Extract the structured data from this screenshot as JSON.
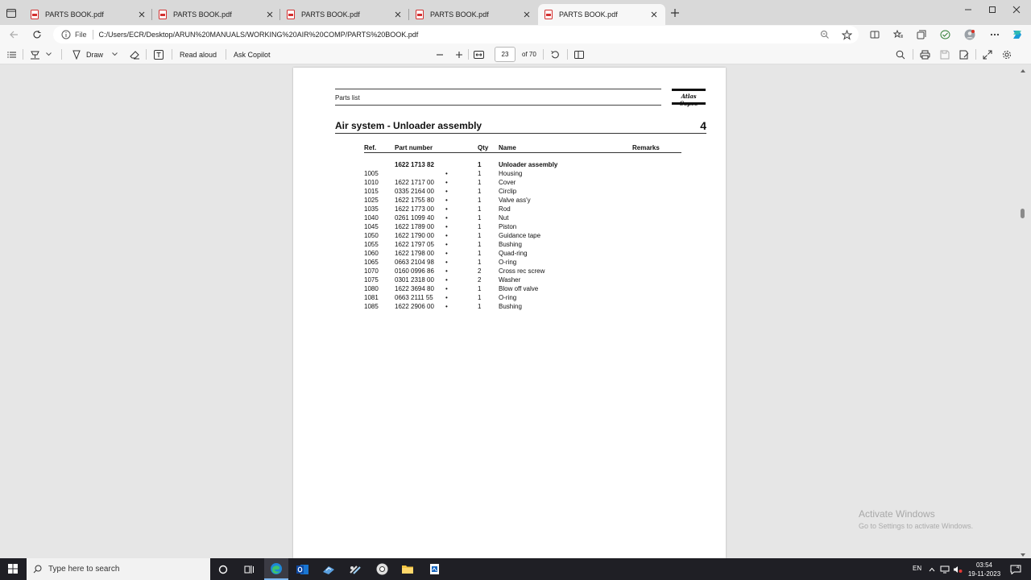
{
  "browser": {
    "tabs": [
      {
        "label": "PARTS BOOK.pdf",
        "active": false
      },
      {
        "label": "PARTS BOOK.pdf",
        "active": false
      },
      {
        "label": "PARTS BOOK.pdf",
        "active": false
      },
      {
        "label": "PARTS BOOK.pdf",
        "active": false
      },
      {
        "label": "PARTS BOOK.pdf",
        "active": true
      }
    ],
    "address": {
      "scheme_label": "File",
      "url": "C:/Users/ECR/Desktop/ARUN%20MANUALS/WORKING%20AIR%20COMP/PARTS%20BOOK.pdf"
    }
  },
  "pdf_toolbar": {
    "draw_label": "Draw",
    "read_aloud_label": "Read aloud",
    "ask_copilot_label": "Ask Copilot",
    "current_page": "23",
    "total_pages_label": "of 70"
  },
  "document": {
    "doc_type": "Parts list",
    "logo_text": "Atlas Copco",
    "section_title": "Air system - Unloader assembly",
    "section_number": "4",
    "columns": {
      "ref": "Ref.",
      "part_number": "Part number",
      "qty": "Qty",
      "name": "Name",
      "remarks": "Remarks"
    },
    "assembly": {
      "ref": "",
      "part_number": "1622 1713 82",
      "qty": "1",
      "name": "Unloader assembly"
    },
    "rows": [
      {
        "ref": "1005",
        "part_number": "",
        "bullet": "•",
        "qty": "1",
        "name": "Housing"
      },
      {
        "ref": "1010",
        "part_number": "1622 1717 00",
        "bullet": "•",
        "qty": "1",
        "name": "Cover"
      },
      {
        "ref": "1015",
        "part_number": "0335 2164 00",
        "bullet": "•",
        "qty": "1",
        "name": "Circlip"
      },
      {
        "ref": "1025",
        "part_number": "1622 1755 80",
        "bullet": "•",
        "qty": "1",
        "name": "Valve ass'y"
      },
      {
        "ref": "1035",
        "part_number": "1622 1773 00",
        "bullet": "•",
        "qty": "1",
        "name": "Rod"
      },
      {
        "ref": "1040",
        "part_number": "0261 1099 40",
        "bullet": "•",
        "qty": "1",
        "name": "Nut"
      },
      {
        "ref": "1045",
        "part_number": "1622 1789 00",
        "bullet": "•",
        "qty": "1",
        "name": "Piston"
      },
      {
        "ref": "1050",
        "part_number": "1622 1790 00",
        "bullet": "•",
        "qty": "1",
        "name": "Guidance tape"
      },
      {
        "ref": "1055",
        "part_number": "1622 1797 05",
        "bullet": "•",
        "qty": "1",
        "name": "Bushing"
      },
      {
        "ref": "1060",
        "part_number": "1622 1798 00",
        "bullet": "•",
        "qty": "1",
        "name": "Quad-ring"
      },
      {
        "ref": "1065",
        "part_number": "0663 2104 98",
        "bullet": "•",
        "qty": "1",
        "name": "O-ring"
      },
      {
        "ref": "1070",
        "part_number": "0160 0996 86",
        "bullet": "•",
        "qty": "2",
        "name": "Cross rec screw"
      },
      {
        "ref": "1075",
        "part_number": "0301 2318 00",
        "bullet": "•",
        "qty": "2",
        "name": "Washer"
      },
      {
        "ref": "1080",
        "part_number": "1622 3694 80",
        "bullet": "•",
        "qty": "1",
        "name": "Blow off valve"
      },
      {
        "ref": "1081",
        "part_number": "0663 2111 55",
        "bullet": "•",
        "qty": "1",
        "name": "O-ring"
      },
      {
        "ref": "1085",
        "part_number": "1622 2906 00",
        "bullet": "•",
        "qty": "1",
        "name": "Bushing"
      }
    ]
  },
  "watermark": {
    "line1": "Activate Windows",
    "line2": "Go to Settings to activate Windows."
  },
  "taskbar": {
    "search_placeholder": "Type here to search",
    "language": "EN",
    "time": "03:54",
    "date": "19-11-2023",
    "notification_count": "4"
  }
}
